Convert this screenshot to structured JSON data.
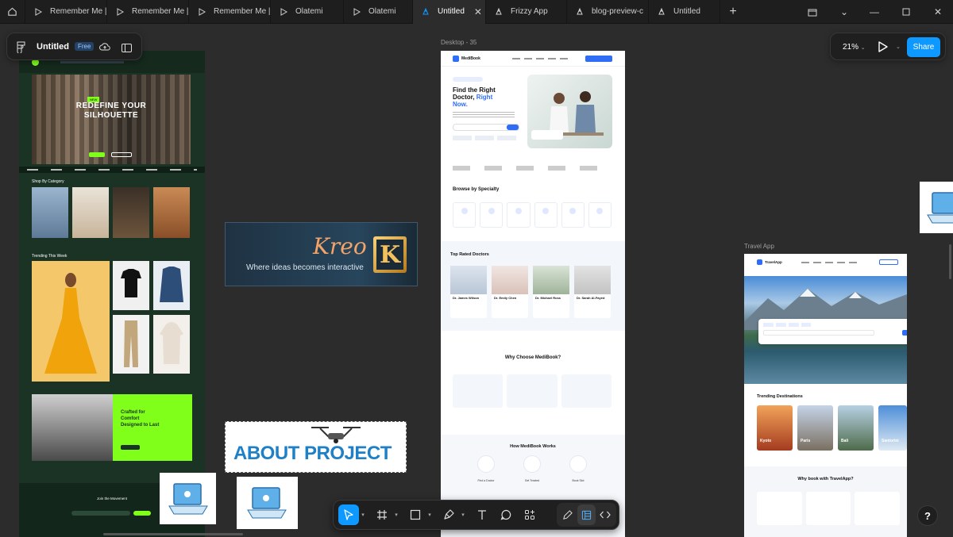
{
  "tabs": [
    {
      "label": "Remember Me |",
      "icon": "play-icon"
    },
    {
      "label": "Remember Me |",
      "icon": "play-icon"
    },
    {
      "label": "Remember Me |",
      "icon": "play-icon"
    },
    {
      "label": "Olatemi",
      "icon": "play-icon"
    },
    {
      "label": "Olatemi",
      "icon": "play-icon"
    },
    {
      "label": "Untitled",
      "icon": "pen-icon",
      "active": true
    },
    {
      "label": "Frizzy App",
      "icon": "pen-icon"
    },
    {
      "label": "blog-preview-c",
      "icon": "pen-icon"
    },
    {
      "label": "Untitled",
      "icon": "pen-icon"
    }
  ],
  "file": {
    "name": "Untitled",
    "plan_badge": "Free"
  },
  "zoom": "21%",
  "share_label": "Share",
  "help_label": "?",
  "frames": {
    "desktop": "Desktop - 35",
    "travel": "Travel App"
  },
  "kreo": {
    "title": "Kreo",
    "tagline": "Where ideas becomes interactive",
    "letter": "K"
  },
  "about": {
    "title": "ABOUT PROJECT"
  },
  "fashion": {
    "hero_line1": "REDEFINE YOUR",
    "hero_line2": "SILHOUETTE",
    "shop_cat": "Shop By Category",
    "trending": "Trending This Week",
    "crafted1": "Crafted for",
    "crafted2": "Comfort",
    "crafted3": "Designed to Last",
    "join": "Join the Movement"
  },
  "medibook": {
    "logo": "MediBook",
    "title1": "Find the Right",
    "title2": "Doctor,",
    "title3": "Right",
    "title4": "Now.",
    "browse": "Browse by Specialty",
    "top_rated": "Top Rated Doctors",
    "doctors": [
      "Dr. James Wilson",
      "Dr. Emily Chen",
      "Dr. Michael Ross",
      "Dr. Sarah Al-Fayed"
    ],
    "why": "Why Choose MediBook?",
    "how": "How MediBook Works",
    "steps": [
      "Find a Doctor",
      "Get Treated",
      "Book Slot"
    ]
  },
  "travel": {
    "logo": "TravelApp",
    "trending": "Trending Destinations",
    "cities": [
      "Kyoto",
      "Paris",
      "Bali",
      "Santorini"
    ],
    "why": "Why book with TravelApp?"
  },
  "colors": {
    "accent": "#0d99ff",
    "canvas": "#2c2c2c",
    "panel": "#1f1f1f",
    "lime": "#7fff1a"
  }
}
